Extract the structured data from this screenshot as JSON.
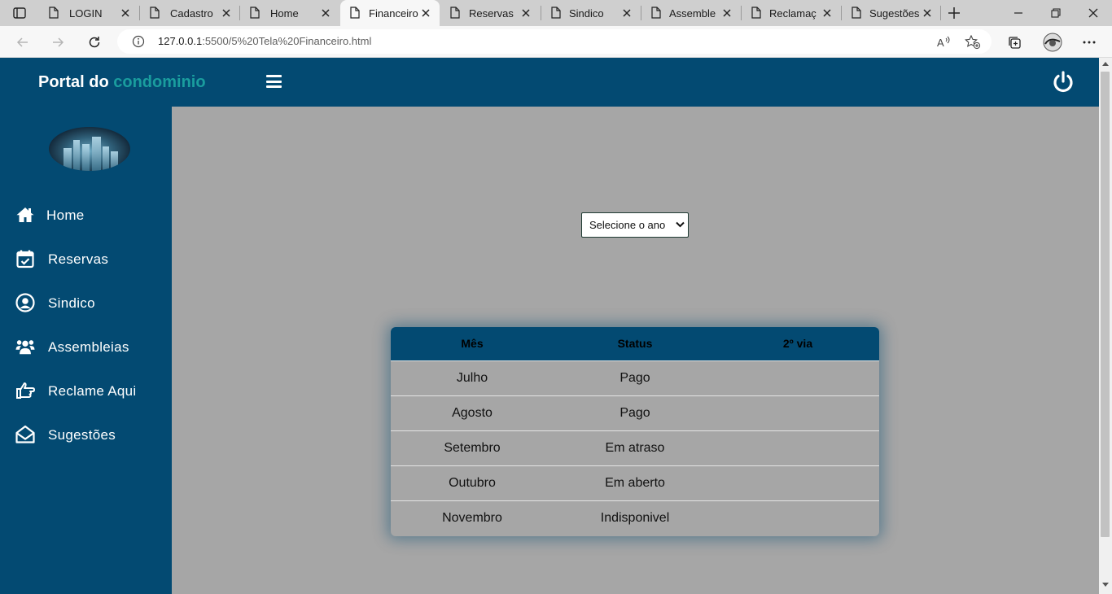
{
  "browser": {
    "tabs": [
      {
        "title": "LOGIN",
        "active": false
      },
      {
        "title": "Cadastro",
        "active": false
      },
      {
        "title": "Home",
        "active": false
      },
      {
        "title": "Financeiro",
        "active": true
      },
      {
        "title": "Reservas",
        "active": false
      },
      {
        "title": "Sindico",
        "active": false
      },
      {
        "title": "Assembleias",
        "active": false
      },
      {
        "title": "Reclamação",
        "active": false
      },
      {
        "title": "Sugestões",
        "active": false
      }
    ],
    "url_host": "127.0.0.1",
    "url_path": ":5500/5%20Tela%20Financeiro.html"
  },
  "header": {
    "brand_prefix": "Portal do ",
    "brand_accent": "condominio"
  },
  "sidebar": {
    "items": [
      {
        "label": "Home",
        "icon": "home-icon"
      },
      {
        "label": "Reservas",
        "icon": "calendar-check-icon"
      },
      {
        "label": "Sindico",
        "icon": "user-circle-icon"
      },
      {
        "label": "Assembleias",
        "icon": "users-icon"
      },
      {
        "label": "Reclame Aqui",
        "icon": "hand-point-icon"
      },
      {
        "label": "Sugestões",
        "icon": "envelope-open-icon"
      }
    ]
  },
  "filter": {
    "year_select": "Selecione o ano"
  },
  "table": {
    "headers": [
      "Mês",
      "Status",
      "2º via"
    ],
    "rows": [
      {
        "month": "Julho",
        "status": "Pago",
        "copy": ""
      },
      {
        "month": "Agosto",
        "status": "Pago",
        "copy": ""
      },
      {
        "month": "Setembro",
        "status": "Em atraso",
        "copy": ""
      },
      {
        "month": "Outubro",
        "status": "Em aberto",
        "copy": ""
      },
      {
        "month": "Novembro",
        "status": "Indisponivel",
        "copy": ""
      }
    ]
  },
  "colors": {
    "primary": "#034a72",
    "accent": "#1a9d9e",
    "background": "#a6a6a6"
  }
}
